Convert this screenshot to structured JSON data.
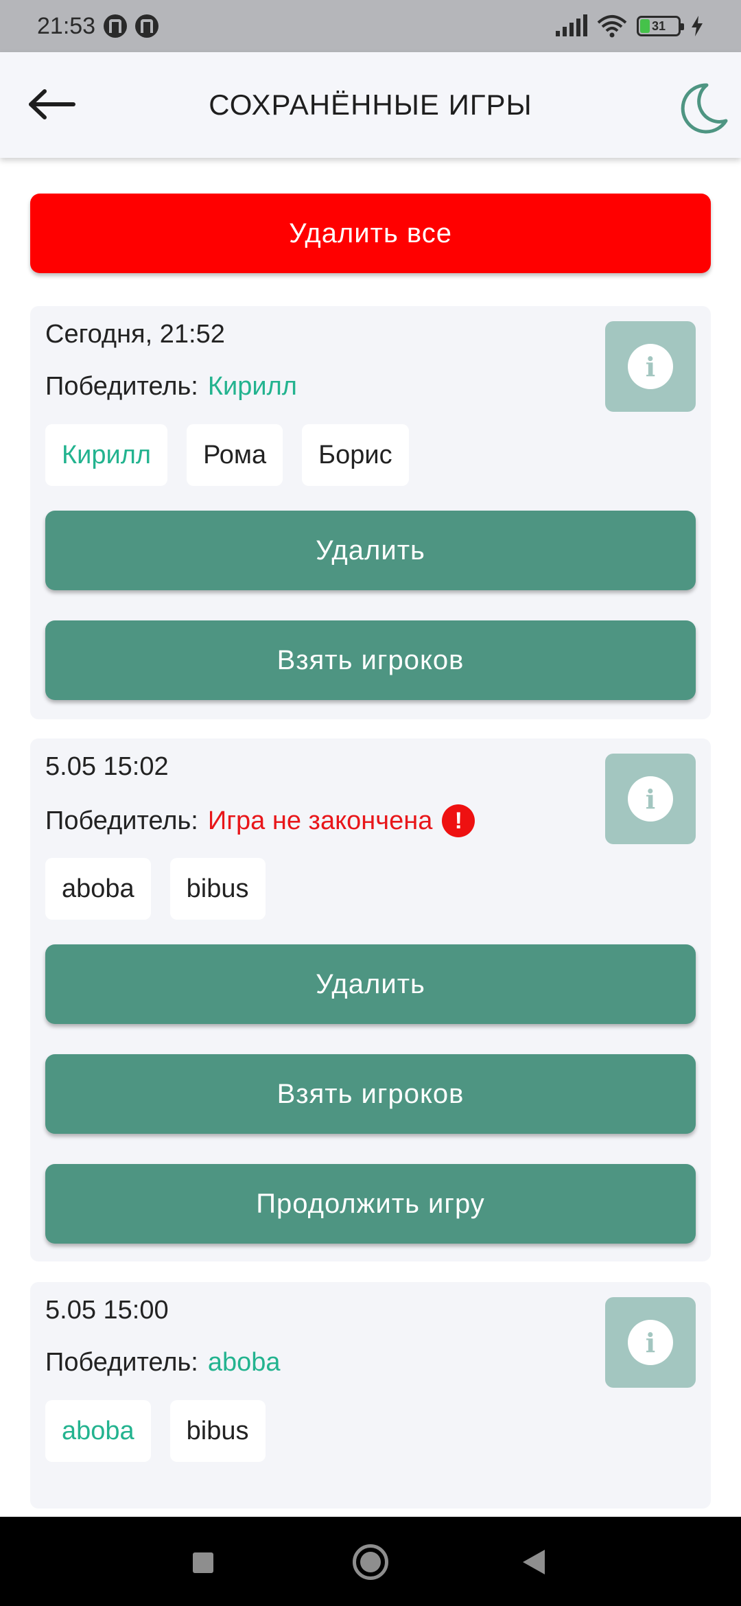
{
  "status_bar": {
    "time": "21:53",
    "battery": "31"
  },
  "app_bar": {
    "title": "СОХРАНЁННЫЕ ИГРЫ"
  },
  "delete_all_label": "Удалить все",
  "winner_label": "Победитель:",
  "games": [
    {
      "date": "Сегодня, 21:52",
      "winner": "Кирилл",
      "players": [
        "Кирилл",
        "Рома",
        "Борис"
      ],
      "delete_label": "Удалить",
      "take_players_label": "Взять игроков"
    },
    {
      "date": "5.05 15:02",
      "winner": "Игра не закончена",
      "players": [
        "aboba",
        "bibus"
      ],
      "delete_label": "Удалить",
      "take_players_label": "Взять игроков",
      "continue_label": "Продолжить игру"
    },
    {
      "date": "5.05 15:00",
      "winner": "aboba",
      "players": [
        "aboba",
        "bibus"
      ]
    }
  ],
  "colors": {
    "accent": "#4e9582",
    "winner": "#23b38f",
    "danger": "#ff0000",
    "card_bg": "#f4f5f9",
    "info_button": "#a3c6c0"
  },
  "icons": {
    "back": "arrow-left-icon",
    "theme": "moon-icon",
    "info": "info-icon",
    "warning": "exclamation-icon"
  }
}
